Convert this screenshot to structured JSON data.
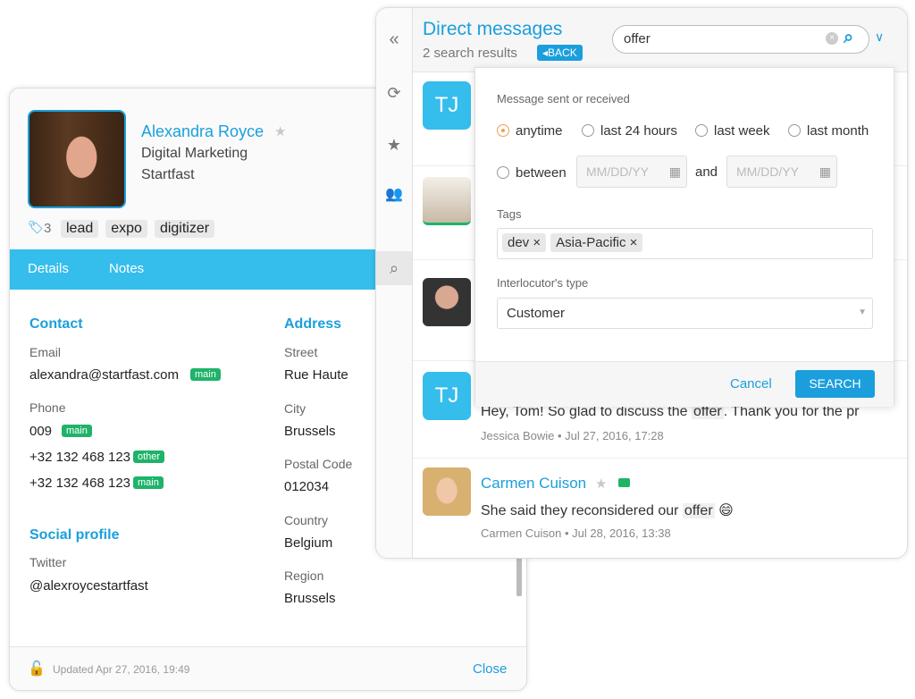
{
  "contact": {
    "name": "Alexandra Royce",
    "title": "Digital Marketing",
    "company": "Startfast",
    "tag_count": "3",
    "tags": [
      "lead",
      "expo",
      "digitizer"
    ],
    "tabs": [
      "Details",
      "Notes"
    ],
    "contact_heading": "Contact",
    "email_label": "Email",
    "email": "alexandra@startfast.com",
    "email_badge": "main",
    "phone_label": "Phone",
    "phones": [
      {
        "number": "009",
        "badge": "main"
      },
      {
        "number": "+32 132 468 123",
        "badge": "other"
      },
      {
        "number": "+32 132 468 123",
        "badge": "main"
      }
    ],
    "social_heading": "Social profile",
    "twitter_label": "Twitter",
    "twitter": "@alexroycestartfast",
    "address_heading": "Address",
    "street_label": "Street",
    "street": "Rue Haute",
    "city_label": "City",
    "city": "Brussels",
    "postal_label": "Postal Code",
    "postal": "012034",
    "country_label": "Country",
    "country": "Belgium",
    "region_label": "Region",
    "region": "Brussels",
    "updated": "Updated  Apr 27, 2016, 19:49",
    "close": "Close"
  },
  "messages": {
    "title": "Direct messages",
    "results": "2 search results",
    "back": "BACK",
    "search_value": "offer",
    "items": [
      {
        "initials": "TJ"
      },
      {},
      {},
      {
        "initials": "TJ",
        "text_before": "Hey, Tom! So glad to discuss the ",
        "highlight": "offer",
        "text_after": ". Thank you for the pr",
        "author": "Jessica Bowie",
        "date": "• Jul 27, 2016, 17:28"
      },
      {
        "name": "Carmen Cuison",
        "text_before": "She said they reconsidered our ",
        "highlight": "offer",
        "emoji": "😄",
        "author": "Carmen Cuison",
        "date": "• Jul 28, 2016, 13:38"
      }
    ]
  },
  "filter": {
    "sent_label": "Message sent or received",
    "options": [
      "anytime",
      "last 24 hours",
      "last week",
      "last month"
    ],
    "selected": "anytime",
    "between": "between",
    "and": "and",
    "date_placeholder": "MM/DD/YY",
    "tags_label": "Tags",
    "tags": [
      "dev",
      "Asia-Pacific"
    ],
    "type_label": "Interlocutor's type",
    "type_value": "Customer",
    "cancel": "Cancel",
    "search": "SEARCH"
  },
  "colors": {
    "accent": "#1a9fdc",
    "tabbar": "#35bdec",
    "badge": "#1fb36a"
  }
}
